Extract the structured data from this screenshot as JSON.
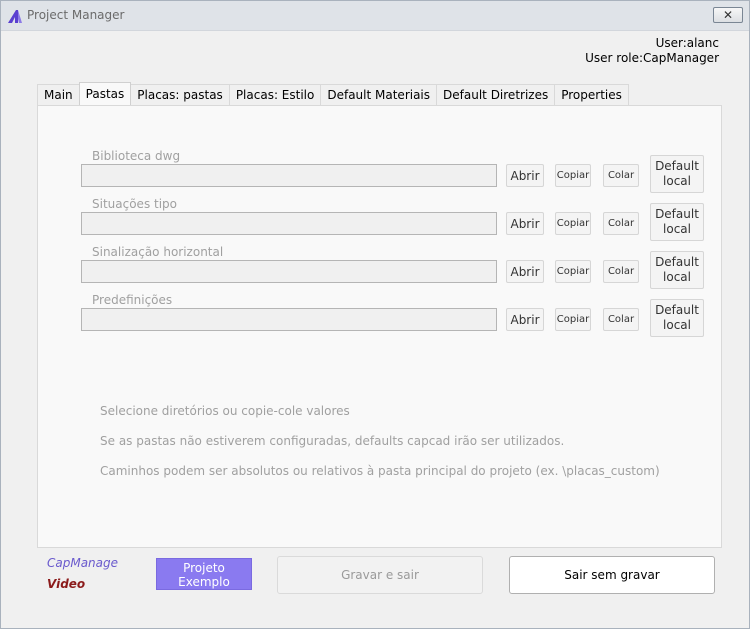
{
  "window": {
    "title": "Project Manager",
    "close_glyph": "✕"
  },
  "user": {
    "name_line": "User:alanc",
    "role_line": "User role:CapManager"
  },
  "tabs": [
    {
      "label": "Main",
      "active": false
    },
    {
      "label": "Pastas",
      "active": true
    },
    {
      "label": "Placas: pastas",
      "active": false
    },
    {
      "label": "Placas: Estilo",
      "active": false
    },
    {
      "label": "Default Materiais",
      "active": false
    },
    {
      "label": "Default Diretrizes",
      "active": false
    },
    {
      "label": "Properties",
      "active": false
    }
  ],
  "groups": [
    {
      "label": "Biblioteca dwg",
      "value": "",
      "open": "Abrir",
      "copy": "Copiar",
      "paste": "Colar",
      "default_line1": "Default",
      "default_line2": "local"
    },
    {
      "label": "Situações tipo",
      "value": "",
      "open": "Abrir",
      "copy": "Copiar",
      "paste": "Colar",
      "default_line1": "Default",
      "default_line2": "local"
    },
    {
      "label": "Sinalização horizontal",
      "value": "",
      "open": "Abrir",
      "copy": "Copiar",
      "paste": "Colar",
      "default_line1": "Default",
      "default_line2": "local"
    },
    {
      "label": "Predefinições",
      "value": "",
      "open": "Abrir",
      "copy": "Copiar",
      "paste": "Colar",
      "default_line1": "Default",
      "default_line2": "local"
    }
  ],
  "info": [
    "Selecione diretórios ou copie-cole valores",
    "Se as pastas não estiverem configuradas, defaults capcad irão ser utilizados.",
    "Caminhos podem ser absolutos ou relativos à pasta principal do projeto (ex. \\placas_custom)"
  ],
  "footer": {
    "capmanage_link": "CapManage",
    "video_link": "Video",
    "projeto_line1": "Projeto",
    "projeto_line2": "Exemplo",
    "save_exit": "Gravar e sair",
    "exit_no_save": "Sair sem gravar"
  },
  "colors": {
    "projeto_button": "#8a7af0",
    "capmanage_link": "#6a5acd",
    "video_link": "#8b1a1a",
    "app_icon": "#5a3fd0"
  },
  "icons": {
    "app": "app-logo-icon",
    "close": "close-icon"
  }
}
